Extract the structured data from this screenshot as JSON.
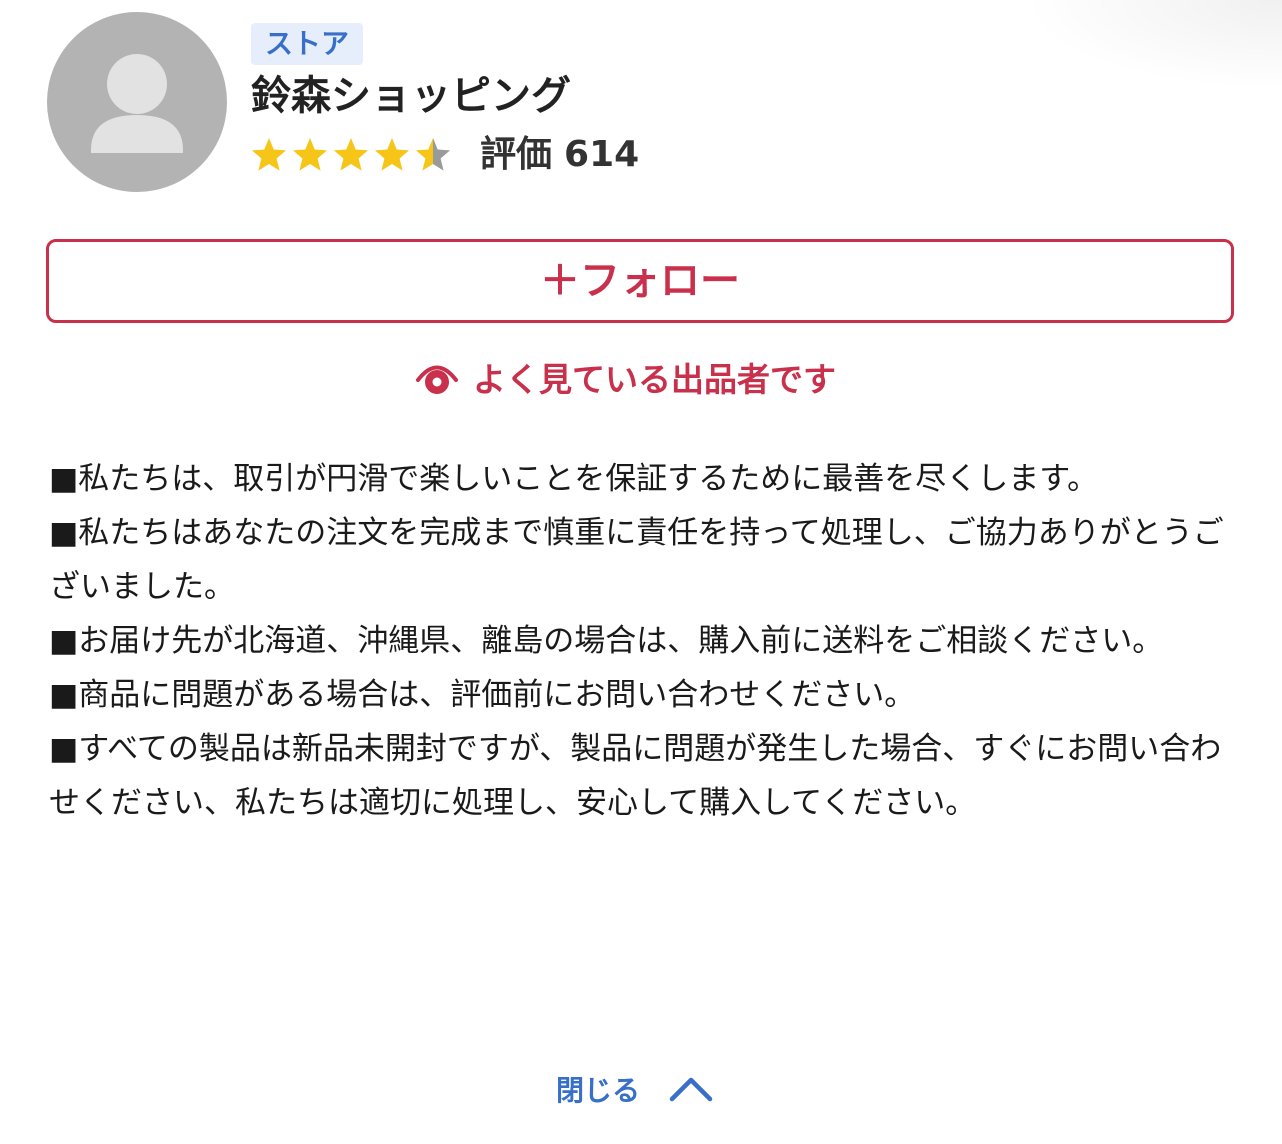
{
  "store": {
    "badge": "ストア",
    "name": "鈴森ショッピング",
    "rating_stars": 4.5,
    "rating_label": "評価",
    "rating_count": "614"
  },
  "follow_button": "＋フォロー",
  "watch_note": "よく見ている出品者です",
  "description": [
    "■私たちは、取引が円滑で楽しいことを保証するために最善を尽くします。",
    "■私たちはあなたの注文を完成まで慎重に責任を持って処理し、ご協力ありがとうございました。",
    "■お届け先が北海道、沖縄県、離島の場合は、購入前に送料をご相談ください。",
    "■商品に問題がある場合は、評価前にお問い合わせください。",
    "■すべての製品は新品未開封ですが、製品に問題が発生した場合、すぐにお問い合わせください、私たちは適切に処理し、安心して購入してください。"
  ],
  "close_link": "閉じる",
  "colors": {
    "accent_red": "#c8304b",
    "link_blue": "#3870c9",
    "star_gold": "#f5c518",
    "avatar_gray": "#b3b3b3"
  },
  "icons": {
    "avatar": "person-placeholder-icon",
    "watch": "eye-icon",
    "close": "chevron-up-icon"
  }
}
